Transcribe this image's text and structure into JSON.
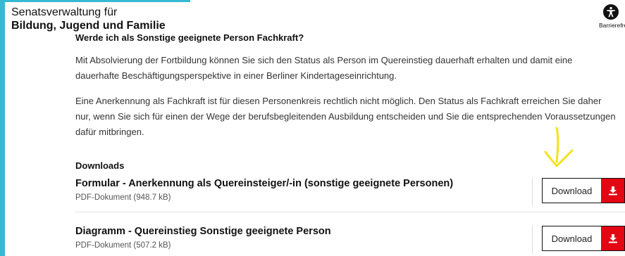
{
  "header": {
    "org_line1": "Senatsverwaltung für",
    "org_line2": "Bildung, Jugend und Familie",
    "accessibility_label": "Barrierefreiheit",
    "accessibility_icon": "accessibility-icon"
  },
  "content": {
    "question_heading": "Werde ich als Sonstige geeignete Person Fachkraft?",
    "paragraph1": "Mit Absolvierung der Fortbildung können Sie sich den Status als Person im Quereinstieg dauerhaft erhalten und damit eine dauerhafte Beschäftigungsperspektive in einer Berliner Kindertageseinrichtung.",
    "paragraph2": "Eine Anerkennung als Fachkraft ist für diesen Personenkreis rechtlich nicht möglich. Den Status als Fachkraft erreichen Sie daher nur, wenn Sie sich für einen der Wege der berufsbegleitenden Ausbildung entscheiden und Sie die entsprechenden Voraussetzungen dafür mitbringen."
  },
  "downloads": {
    "title": "Downloads",
    "items": [
      {
        "title": "Formular - Anerkennung als Quereinsteiger/-in (sonstige geeignete Personen)",
        "meta": "PDF-Dokument (948.7 kB)",
        "button_label": "Download",
        "icon": "download-icon"
      },
      {
        "title": "Diagramm - Quereinstieg Sonstige geeignete Person",
        "meta": "PDF-Dokument (507.2 kB)",
        "button_label": "Download",
        "icon": "download-icon"
      }
    ]
  },
  "colors": {
    "frame": "#37b9d4",
    "download_accent": "#e30613",
    "annotation_arrow": "#f5e11c"
  }
}
